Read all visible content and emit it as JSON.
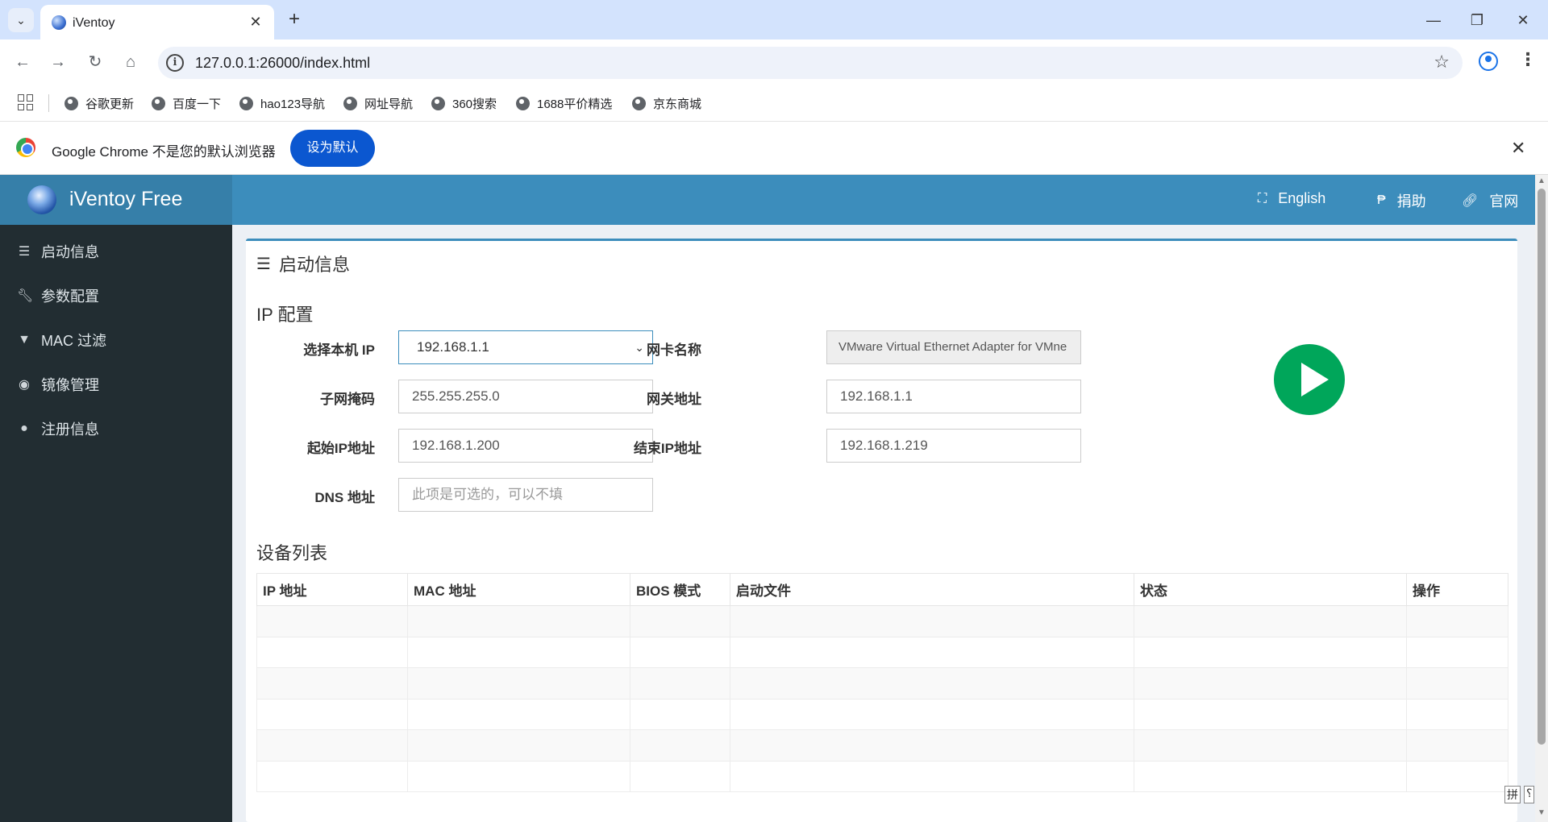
{
  "browser": {
    "tab_title": "iVentoy",
    "url": "127.0.0.1:26000/index.html",
    "bookmarks": [
      "谷歌更新",
      "百度一下",
      "hao123导航",
      "网址导航",
      "360搜索",
      "1688平价精选",
      "京东商城"
    ],
    "infobar": {
      "message": "Google Chrome 不是您的默认浏览器",
      "button": "设为默认"
    }
  },
  "app": {
    "logo": "iVentoy Free",
    "topnav": {
      "language": "English",
      "donate": "捐助",
      "website": "官网"
    },
    "sidebar": [
      {
        "label": "启动信息",
        "icon": "server-icon"
      },
      {
        "label": "参数配置",
        "icon": "wrench-icon"
      },
      {
        "label": "MAC 过滤",
        "icon": "filter-icon"
      },
      {
        "label": "镜像管理",
        "icon": "disc-icon"
      },
      {
        "label": "注册信息",
        "icon": "user-icon"
      }
    ],
    "panel_title": "启动信息",
    "ip_config": {
      "title": "IP 配置",
      "select_ip_label": "选择本机 IP",
      "select_ip_value": "192.168.1.1",
      "nic_label": "网卡名称",
      "nic_value": "VMware Virtual Ethernet Adapter for VMne",
      "subnet_label": "子网掩码",
      "subnet_value": "255.255.255.0",
      "gateway_label": "网关地址",
      "gateway_value": "192.168.1.1",
      "start_ip_label": "起始IP地址",
      "start_ip_value": "192.168.1.200",
      "end_ip_label": "结束IP地址",
      "end_ip_value": "192.168.1.219",
      "dns_label": "DNS 地址",
      "dns_placeholder": "此项是可选的，可以不填"
    },
    "device_list": {
      "title": "设备列表",
      "columns": [
        "IP 地址",
        "MAC 地址",
        "BIOS 模式",
        "启动文件",
        "状态",
        "操作"
      ],
      "rows": []
    },
    "ime": [
      "拼",
      "⸮"
    ]
  },
  "colors": {
    "header_blue": "#3c8dbc",
    "logo_blue": "#367fa9",
    "sidebar_dark": "#222d32",
    "play_green": "#00a65a",
    "chrome_button": "#0b57d0"
  }
}
